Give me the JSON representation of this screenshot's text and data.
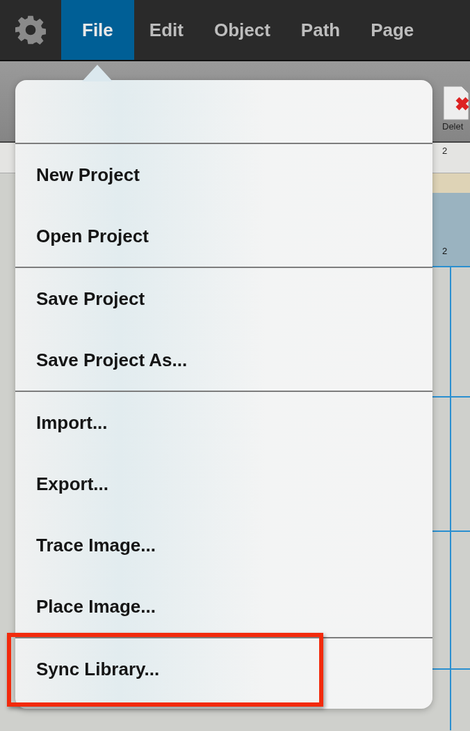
{
  "menubar": {
    "items": [
      {
        "label": "File",
        "selected": true
      },
      {
        "label": "Edit",
        "selected": false
      },
      {
        "label": "Object",
        "selected": false
      },
      {
        "label": "Path",
        "selected": false
      },
      {
        "label": "Page",
        "selected": false
      }
    ]
  },
  "toolbar": {
    "delete_label": "Delet"
  },
  "rulers": {
    "top_tick": "2",
    "side_tick": "2"
  },
  "file_menu": {
    "groups": [
      {
        "items": [
          {
            "label": "New Project",
            "highlighted": false
          },
          {
            "label": "Open Project",
            "highlighted": false
          }
        ]
      },
      {
        "items": [
          {
            "label": "Save Project",
            "highlighted": false
          },
          {
            "label": "Save Project As...",
            "highlighted": false
          }
        ]
      },
      {
        "items": [
          {
            "label": "Import...",
            "highlighted": false
          },
          {
            "label": "Export...",
            "highlighted": false
          },
          {
            "label": "Trace Image...",
            "highlighted": false
          },
          {
            "label": "Place Image...",
            "highlighted": false
          }
        ]
      },
      {
        "items": [
          {
            "label": "Sync Library...",
            "highlighted": true
          }
        ]
      }
    ]
  }
}
